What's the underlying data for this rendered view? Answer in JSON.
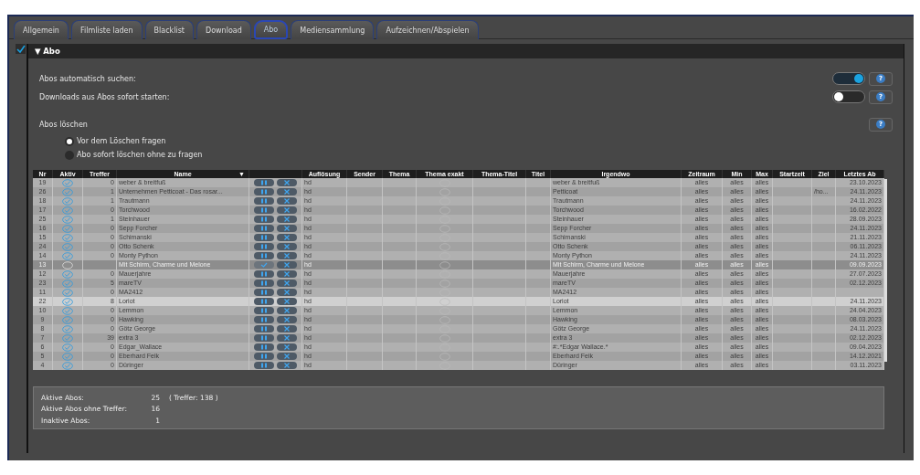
{
  "tabs": [
    {
      "label": "Allgemein",
      "selected": false
    },
    {
      "label": "Filmliste laden",
      "selected": false
    },
    {
      "label": "Blacklist",
      "selected": false
    },
    {
      "label": "Download",
      "selected": false
    },
    {
      "label": "Abo",
      "selected": true
    },
    {
      "label": "Mediensammlung",
      "selected": false
    },
    {
      "label": "Aufzeichnen/Abspielen",
      "selected": false
    }
  ],
  "section": {
    "title": "Abo",
    "expanded": true,
    "checked": true,
    "arrow": "▼"
  },
  "settings": [
    {
      "label": "Abos automatisch suchen:",
      "on": true,
      "help": "?"
    },
    {
      "label": "Downloads aus Abos sofort starten:",
      "on": false,
      "help": "?"
    }
  ],
  "delete": {
    "label": "Abos löschen",
    "help": "?",
    "options": [
      {
        "label": "Vor dem Löschen fragen",
        "selected": true
      },
      {
        "label": "Abo sofort löschen ohne zu fragen",
        "selected": false
      }
    ]
  },
  "table": {
    "columns": [
      {
        "label": "Nr"
      },
      {
        "label": "Aktiv"
      },
      {
        "label": "Treffer"
      },
      {
        "label": "Name",
        "sort": "▼"
      },
      {
        "label": "Auflösung"
      },
      {
        "label": "Sender"
      },
      {
        "label": "Thema"
      },
      {
        "label": "Thema exakt"
      },
      {
        "label": "Thema-Titel"
      },
      {
        "label": "Titel"
      },
      {
        "label": "Irgendwo"
      },
      {
        "label": "Zeitraum"
      },
      {
        "label": "Min"
      },
      {
        "label": "Max"
      },
      {
        "label": "Startzeit"
      },
      {
        "label": "Ziel"
      },
      {
        "label": "Letztes Ab"
      }
    ],
    "rows": [
      {
        "nr": "19",
        "active": true,
        "treffer": "0",
        "name": "weber & breitfuß",
        "aufloesung": "hd",
        "irgendwo": "weber & breitfuß",
        "zeitraum": "alles",
        "min": "alles",
        "max": "alles",
        "ziel": "",
        "letztes": "23.10.2023",
        "selected": false
      },
      {
        "nr": "26",
        "active": true,
        "treffer": "1",
        "name": "Unternehmen Petticoat - Das rosar...",
        "aufloesung": "hd",
        "irgendwo": "Petticoat",
        "zeitraum": "alles",
        "min": "alles",
        "max": "alles",
        "ziel": "/ho...",
        "letztes": "24.11.2023",
        "selected": false
      },
      {
        "nr": "18",
        "active": true,
        "treffer": "1",
        "name": "Trautmann",
        "aufloesung": "hd",
        "irgendwo": "Trautmann",
        "zeitraum": "alles",
        "min": "alles",
        "max": "alles",
        "ziel": "",
        "letztes": "24.11.2023",
        "selected": false
      },
      {
        "nr": "17",
        "active": true,
        "treffer": "0",
        "name": "Torchwood",
        "aufloesung": "hd",
        "irgendwo": "Torchwood",
        "zeitraum": "alles",
        "min": "alles",
        "max": "alles",
        "ziel": "",
        "letztes": "16.02.2022",
        "selected": false
      },
      {
        "nr": "25",
        "active": true,
        "treffer": "1",
        "name": "Steinhauer",
        "aufloesung": "hd",
        "irgendwo": "Steinhauer",
        "zeitraum": "alles",
        "min": "alles",
        "max": "alles",
        "ziel": "",
        "letztes": "28.09.2023",
        "selected": false
      },
      {
        "nr": "16",
        "active": true,
        "treffer": "0",
        "name": "Sepp Forcher",
        "aufloesung": "hd",
        "irgendwo": "Sepp Forcher",
        "zeitraum": "alles",
        "min": "alles",
        "max": "alles",
        "ziel": "",
        "letztes": "24.11.2023",
        "selected": false
      },
      {
        "nr": "15",
        "active": true,
        "treffer": "0",
        "name": "Schimanski",
        "aufloesung": "hd",
        "irgendwo": "Schimanski",
        "zeitraum": "alles",
        "min": "alles",
        "max": "alles",
        "ziel": "",
        "letztes": "21.11.2023",
        "selected": false
      },
      {
        "nr": "24",
        "active": true,
        "treffer": "0",
        "name": "Otto Schenk",
        "aufloesung": "hd",
        "irgendwo": "Otto Schenk",
        "zeitraum": "alles",
        "min": "alles",
        "max": "alles",
        "ziel": "",
        "letztes": "06.11.2023",
        "selected": false
      },
      {
        "nr": "14",
        "active": true,
        "treffer": "0",
        "name": "Monty Python",
        "aufloesung": "hd",
        "irgendwo": "Monty Python",
        "zeitraum": "alles",
        "min": "alles",
        "max": "alles",
        "ziel": "",
        "letztes": "24.11.2023",
        "selected": false
      },
      {
        "nr": "13",
        "active": false,
        "treffer": "",
        "name": "Mit Schirm, Charme und Melone",
        "aufloesung": "hd",
        "irgendwo": "Mit Schirm, Charme und Melone",
        "zeitraum": "alles",
        "min": "alles",
        "max": "alles",
        "ziel": "",
        "letztes": "09.09.2023",
        "selected": false
      },
      {
        "nr": "12",
        "active": true,
        "treffer": "0",
        "name": "Mauerjahre",
        "aufloesung": "hd",
        "irgendwo": "Mauerjahre",
        "zeitraum": "alles",
        "min": "alles",
        "max": "alles",
        "ziel": "",
        "letztes": "27.07.2023",
        "selected": false
      },
      {
        "nr": "23",
        "active": true,
        "treffer": "5",
        "name": "mareTV",
        "aufloesung": "hd",
        "irgendwo": "mareTV",
        "zeitraum": "alles",
        "min": "alles",
        "max": "alles",
        "ziel": "",
        "letztes": "02.12.2023",
        "selected": false
      },
      {
        "nr": "11",
        "active": true,
        "treffer": "0",
        "name": "MA2412",
        "aufloesung": "hd",
        "irgendwo": "MA2412",
        "zeitraum": "alles",
        "min": "alles",
        "max": "alles",
        "ziel": "",
        "letztes": "",
        "selected": false
      },
      {
        "nr": "22",
        "active": true,
        "treffer": "8",
        "name": "Loriot",
        "aufloesung": "hd",
        "irgendwo": "Loriot",
        "zeitraum": "alles",
        "min": "alles",
        "max": "alles",
        "ziel": "",
        "letztes": "24.11.2023",
        "selected": true
      },
      {
        "nr": "10",
        "active": true,
        "treffer": "0",
        "name": "Lemmon",
        "aufloesung": "hd",
        "irgendwo": "Lemmon",
        "zeitraum": "alles",
        "min": "alles",
        "max": "alles",
        "ziel": "",
        "letztes": "24.04.2023",
        "selected": false
      },
      {
        "nr": "9",
        "active": true,
        "treffer": "0",
        "name": "Hawking",
        "aufloesung": "hd",
        "irgendwo": "Hawking",
        "zeitraum": "alles",
        "min": "alles",
        "max": "alles",
        "ziel": "",
        "letztes": "08.03.2023",
        "selected": false
      },
      {
        "nr": "8",
        "active": true,
        "treffer": "0",
        "name": "Götz George",
        "aufloesung": "hd",
        "irgendwo": "Götz George",
        "zeitraum": "alles",
        "min": "alles",
        "max": "alles",
        "ziel": "",
        "letztes": "24.11.2023",
        "selected": false
      },
      {
        "nr": "7",
        "active": true,
        "treffer": "39",
        "name": "extra 3",
        "aufloesung": "hd",
        "irgendwo": "extra 3",
        "zeitraum": "alles",
        "min": "alles",
        "max": "alles",
        "ziel": "",
        "letztes": "02.12.2023",
        "selected": false
      },
      {
        "nr": "6",
        "active": true,
        "treffer": "0",
        "name": "Edgar_Wallace",
        "aufloesung": "hd",
        "irgendwo": "#:.*Edgar Wallace.*",
        "zeitraum": "alles",
        "min": "alles",
        "max": "alles",
        "ziel": "",
        "letztes": "09.04.2023",
        "selected": false
      },
      {
        "nr": "5",
        "active": true,
        "treffer": "0",
        "name": "Eberhard Feik",
        "aufloesung": "hd",
        "irgendwo": "Eberhard Feik",
        "zeitraum": "alles",
        "min": "alles",
        "max": "alles",
        "ziel": "",
        "letztes": "14.12.2021",
        "selected": false
      },
      {
        "nr": "4",
        "active": true,
        "treffer": "0",
        "name": "Düringer",
        "aufloesung": "hd",
        "irgendwo": "Düringer",
        "zeitraum": "alles",
        "min": "alles",
        "max": "alles",
        "ziel": "",
        "letztes": "03.11.2023",
        "selected": false
      }
    ]
  },
  "stats": [
    {
      "label": "Aktive Abos:",
      "value": "25",
      "extra": "( Treffer: 138 )"
    },
    {
      "label": "Aktive Abos ohne Treffer:",
      "value": "16"
    },
    {
      "label": "Inaktive Abos:",
      "value": "1"
    }
  ]
}
